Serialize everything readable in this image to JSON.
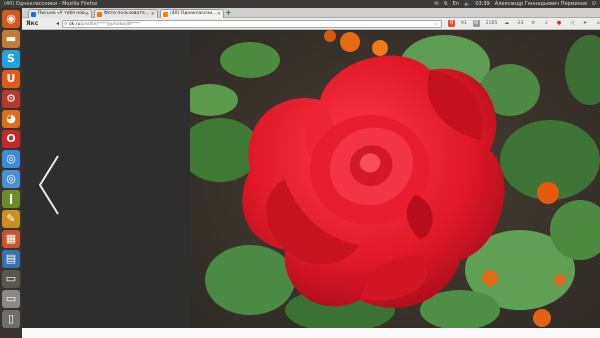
{
  "system_bar": {
    "window_title": "(40) Одноклассники - Mozilla Firefox",
    "clock": "03:39",
    "user_name": "Александр Геннадьевич Перминов"
  },
  "tabs": [
    {
      "label": "Письма «У тебя нов…",
      "favicon_color": "#2a6fbf"
    },
    {
      "label": "Фото пользовате…",
      "favicon_color": "#e07b1a"
    },
    {
      "label": "(40) Одноклассни…",
      "favicon_color": "#f08a00"
    }
  ],
  "navbar": {
    "brand": "Якс",
    "url_host": "ok.ru",
    "url_path": "/profile/****/pphotos/8****",
    "search_badge": "91",
    "counter_1": "2165",
    "temperature": "-23"
  },
  "launcher": {
    "items": [
      {
        "name": "ubuntu-logo-icon",
        "color": "#d25a1f",
        "glyph": "◉"
      },
      {
        "name": "files-icon",
        "color": "#c57a36",
        "glyph": "▬"
      },
      {
        "name": "skype-icon",
        "color": "#1fa3e0",
        "glyph": "S"
      },
      {
        "name": "ubuntu-one-icon",
        "color": "#e05a1a",
        "glyph": "U"
      },
      {
        "name": "settings-icon",
        "color": "#b33a2e",
        "glyph": "⚙"
      },
      {
        "name": "firefox-icon",
        "color": "#e06d1a",
        "glyph": "◕"
      },
      {
        "name": "opera-icon",
        "color": "#c9262a",
        "glyph": "O"
      },
      {
        "name": "chrome-icon",
        "color": "#3b8bd8",
        "glyph": "◎"
      },
      {
        "name": "chromium-icon",
        "color": "#4d8fd6",
        "glyph": "◎"
      },
      {
        "name": "system-monitor-icon",
        "color": "#6a8d2a",
        "glyph": "ǀ"
      },
      {
        "name": "text-editor-icon",
        "color": "#c89020",
        "glyph": "✎"
      },
      {
        "name": "image-viewer-icon",
        "color": "#c9552f",
        "glyph": "▦"
      },
      {
        "name": "document-viewer-icon",
        "color": "#3a6fb0",
        "glyph": "▤"
      },
      {
        "name": "terminal-icon",
        "color": "#57564f",
        "glyph": "▭"
      },
      {
        "name": "removable-drive-icon",
        "color": "#8a8a8a",
        "glyph": "▭"
      },
      {
        "name": "trash-icon",
        "color": "#6e6e6e",
        "glyph": "▯"
      }
    ]
  },
  "viewer": {
    "panel_bg": "#2e2e2e",
    "rose_color": "#e01a2a",
    "leaf_color": "#3f7a35"
  }
}
